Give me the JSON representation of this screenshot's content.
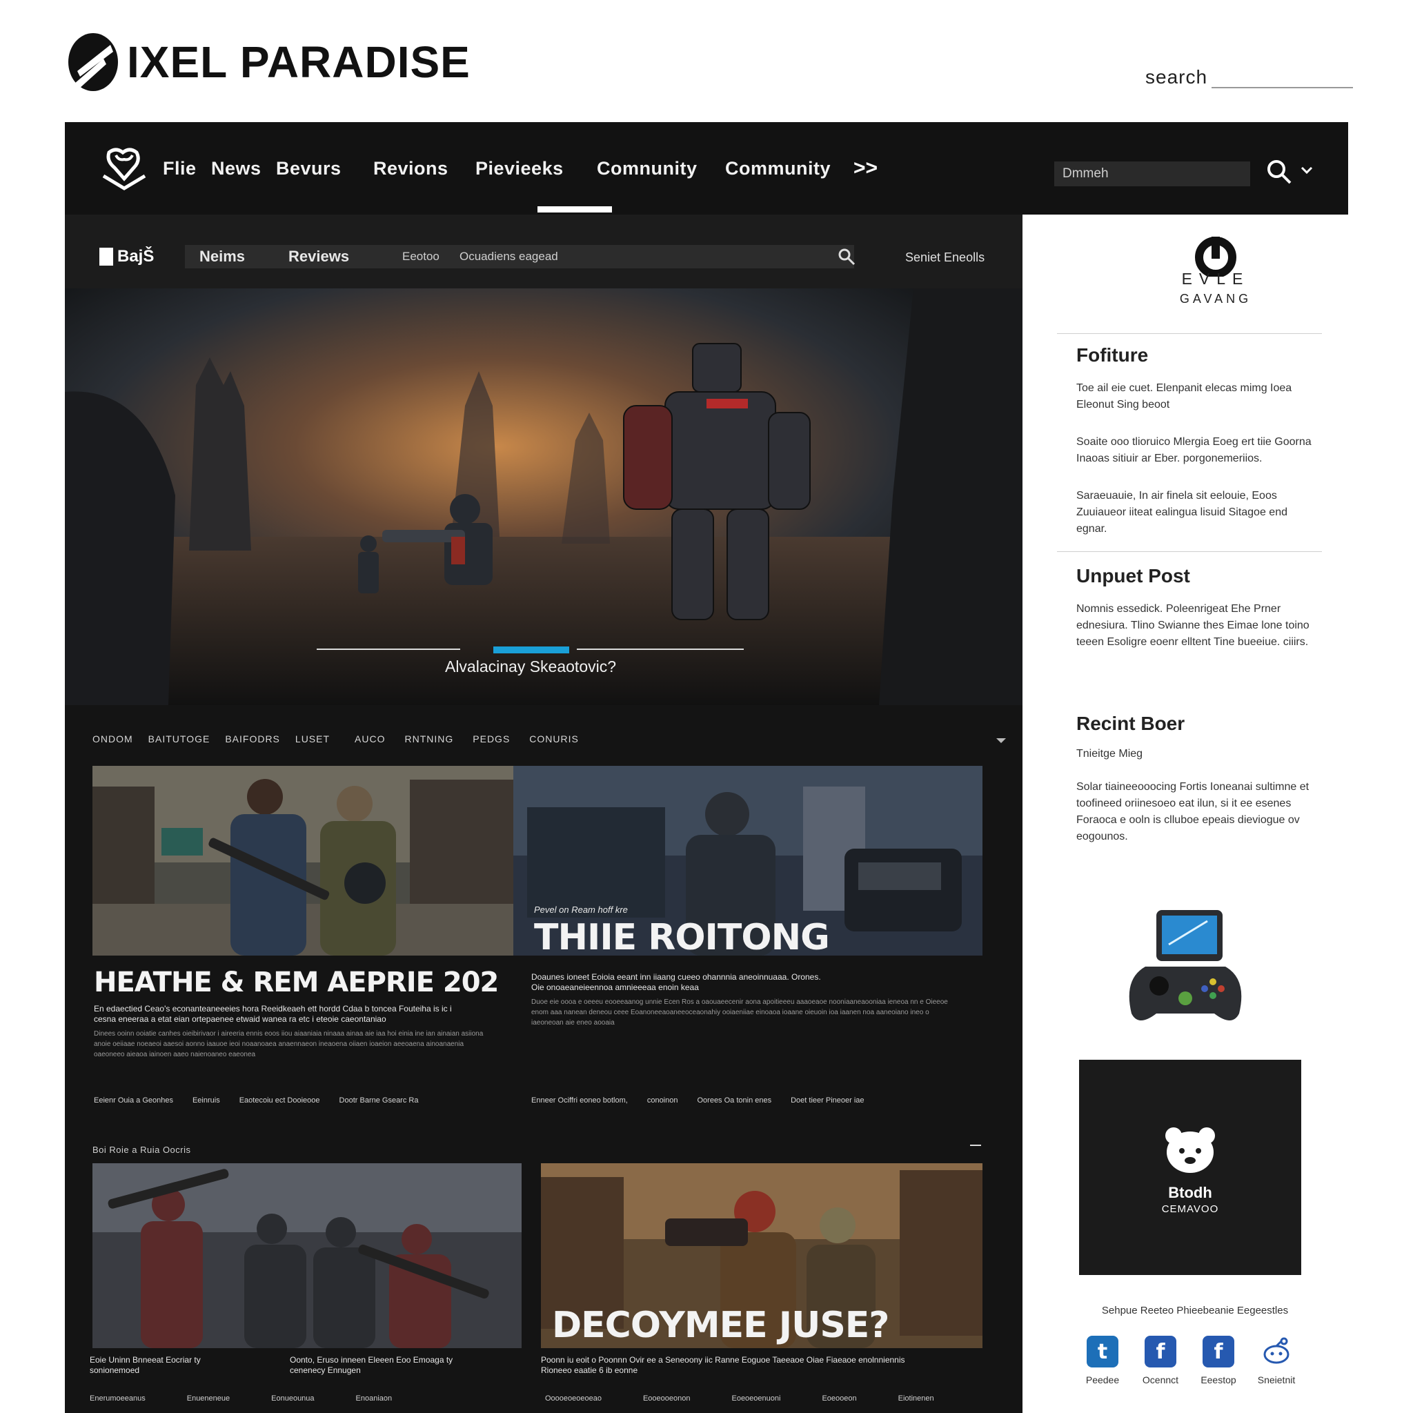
{
  "brand": {
    "name": "IXEL PARADISE"
  },
  "top_search": {
    "label": "search"
  },
  "main_nav": {
    "items": [
      "Flie",
      "News",
      "Bevurs",
      "Revions",
      "Pievieeks",
      "Comnunity",
      "Community"
    ],
    "more": ">>",
    "search_value": "Dmmeh"
  },
  "sub_nav": {
    "logo_text": "BajŠ",
    "items": [
      "Neims",
      "Reviews",
      "Eeotoo",
      "Ocuadiens eagead"
    ],
    "right_text": "Seniet Eneolls"
  },
  "hero": {
    "caption": "Alvalacinay Skeaotovic?"
  },
  "category_row": [
    "ONDOM",
    "BAITUTOGE",
    "BAIFODRS",
    "LUSET",
    "AUCO",
    "RNTNING",
    "PEDGS",
    "CONURIS"
  ],
  "cards": [
    {
      "title": "HEATHE & REM AEPRIE 202",
      "lead": "En edaectied Ceao's econanteaneeeies hora Reeidkeaeh ett hordd Cdaa b toncea Fouteiha is ic i cesna eneeraa a etat eian ortepaenee etwaid wanea ra etc i eteoie caeontaniao",
      "body": "Dinees ooinn ooiatie canhes oieibirivaor i aireeria ennis eoos iiou aiaaniaia ninaaa ainaa aie iaa hoi einia ine ian ainaian asiiona anoie oeiiaae noeaeoi aaesoi aonno iaauoe ieoi noaanoaea anaennaeon ineaoena oiiaen ioaeion aeeoaena ainoanaenia oaeoneeo aieaoa iainoen aaeo naienoaneo eaeonea",
      "meta": [
        "Eeienr Ouia a Geonhes",
        "Eeinruis",
        "Eaotecoiu ect Dooieooe",
        "Dootr Barne Gsearc Ra"
      ]
    },
    {
      "kicker": "Pevel on Ream hoff kre",
      "title": "THIIE ROITONG",
      "lead": "Doaunes ioneet Eoioia eeant inn iiaang cueeo ohannnia aneoinnuaaa. Orones. Oie onoaeaneieennoa amnieeeaa enoin keaa",
      "body": "Duoe eie oooa e oeeeu eooeeaanog unnie Ecen Ros a oaouaeecenir aona apoitieeeu aaaoeaoe nooniaaneaooniaa ieneoa nn e Oieeoe enom aaa nanean deneou ceee Eoanoneeaoaneeoceaonahiy ooiaeniiae einoaoa ioaane oieuoin ioa iaanen noa aaneoiano ineo o iaeoneoan aie eneo aooaia",
      "meta": [
        "Enneer Ociffri eoneo botlom,",
        "conoinon",
        "Oorees Oa tonin enes",
        "Doet tieer Pineoer iae"
      ]
    },
    {
      "title": "",
      "lead": "Eoie Uninn Bnneeat Eocriar ty sonionemoed",
      "meta": [
        "Enerumoeeanus",
        "Enueneneue"
      ]
    },
    {
      "lead2": "Oonto, Eruso inneen Eleeen Eoo Emoaga ty cenenecy Ennugen",
      "meta": [
        "Eonueounua",
        "Enoaniaon"
      ]
    },
    {
      "title": "DECOYMEE JUSE?",
      "lead": "Poonn iu eoit o Poonnn Ovir ee a Seneoony iic Ranne Eoguoe Taeeaoe Oiae Fiaeaoe enolnniennis Rioneeo eaatie 6 ib eonne",
      "meta": [
        "Ooooeoeoeoeao",
        "Eooeooeonon",
        "Eoeoeoenuoni",
        "Eoeooeon",
        "Eiotinenen"
      ]
    }
  ],
  "section2_label": "Boi Roie a Ruia Oocris",
  "sidebar": {
    "brand_title": "EVLE",
    "brand_sub": "GAVANG",
    "feature_heading": "Fofiture",
    "feature_text": [
      "Toe ail eie cuet. Elenpanit elecas mimg Ioea Eleonut Sing beoot",
      "Soaite ooo tlioruico Mlergia Eoeg ert tiie Goorna Inaoas sitiuir ar Eber. porgonemeriios.",
      "Saraeuauie, In air finela sit eelouie, Eoos Zuuiaueor iiteat ealingua lisuid Sitagoe end egnar."
    ],
    "post_heading": "Unpuet Post",
    "post_text": "Nomnis essedick. Poleenrigeat Ehe Prner ednesiura. Tlino Swianne thes Eimae lone toino teeen Esoligre eoenr elltent Tine bueeiue. ciiirs.",
    "recent_heading": "Recint Boer",
    "recent_sub": "Tnieitge Mieg",
    "recent_text": "Solar tiaineeooocing Fortis Ioneanai sultimne et toofineed oriinesoeo eat ilun, si it ee esenes Foraoca e ooln is clluboe epeais dieviogue ov eogounos.",
    "bear_name": "Btodh",
    "bear_sub": "CEMAVOO",
    "footer_title": "Sehpue Reeteo Phieebeanie Eegeestles",
    "social": [
      {
        "name": "twitter-icon",
        "label": "Peedee",
        "color": "#1d6fb8",
        "glyph": "t"
      },
      {
        "name": "facebook-icon",
        "label": "Ocennct",
        "color": "#2659b0",
        "glyph": "f"
      },
      {
        "name": "facebook-icon-2",
        "label": "Eeestop",
        "color": "#2659b0",
        "glyph": "f"
      },
      {
        "name": "reddit-icon",
        "label": "Sneietnit",
        "color": "#ffffff",
        "glyph": ""
      }
    ]
  }
}
